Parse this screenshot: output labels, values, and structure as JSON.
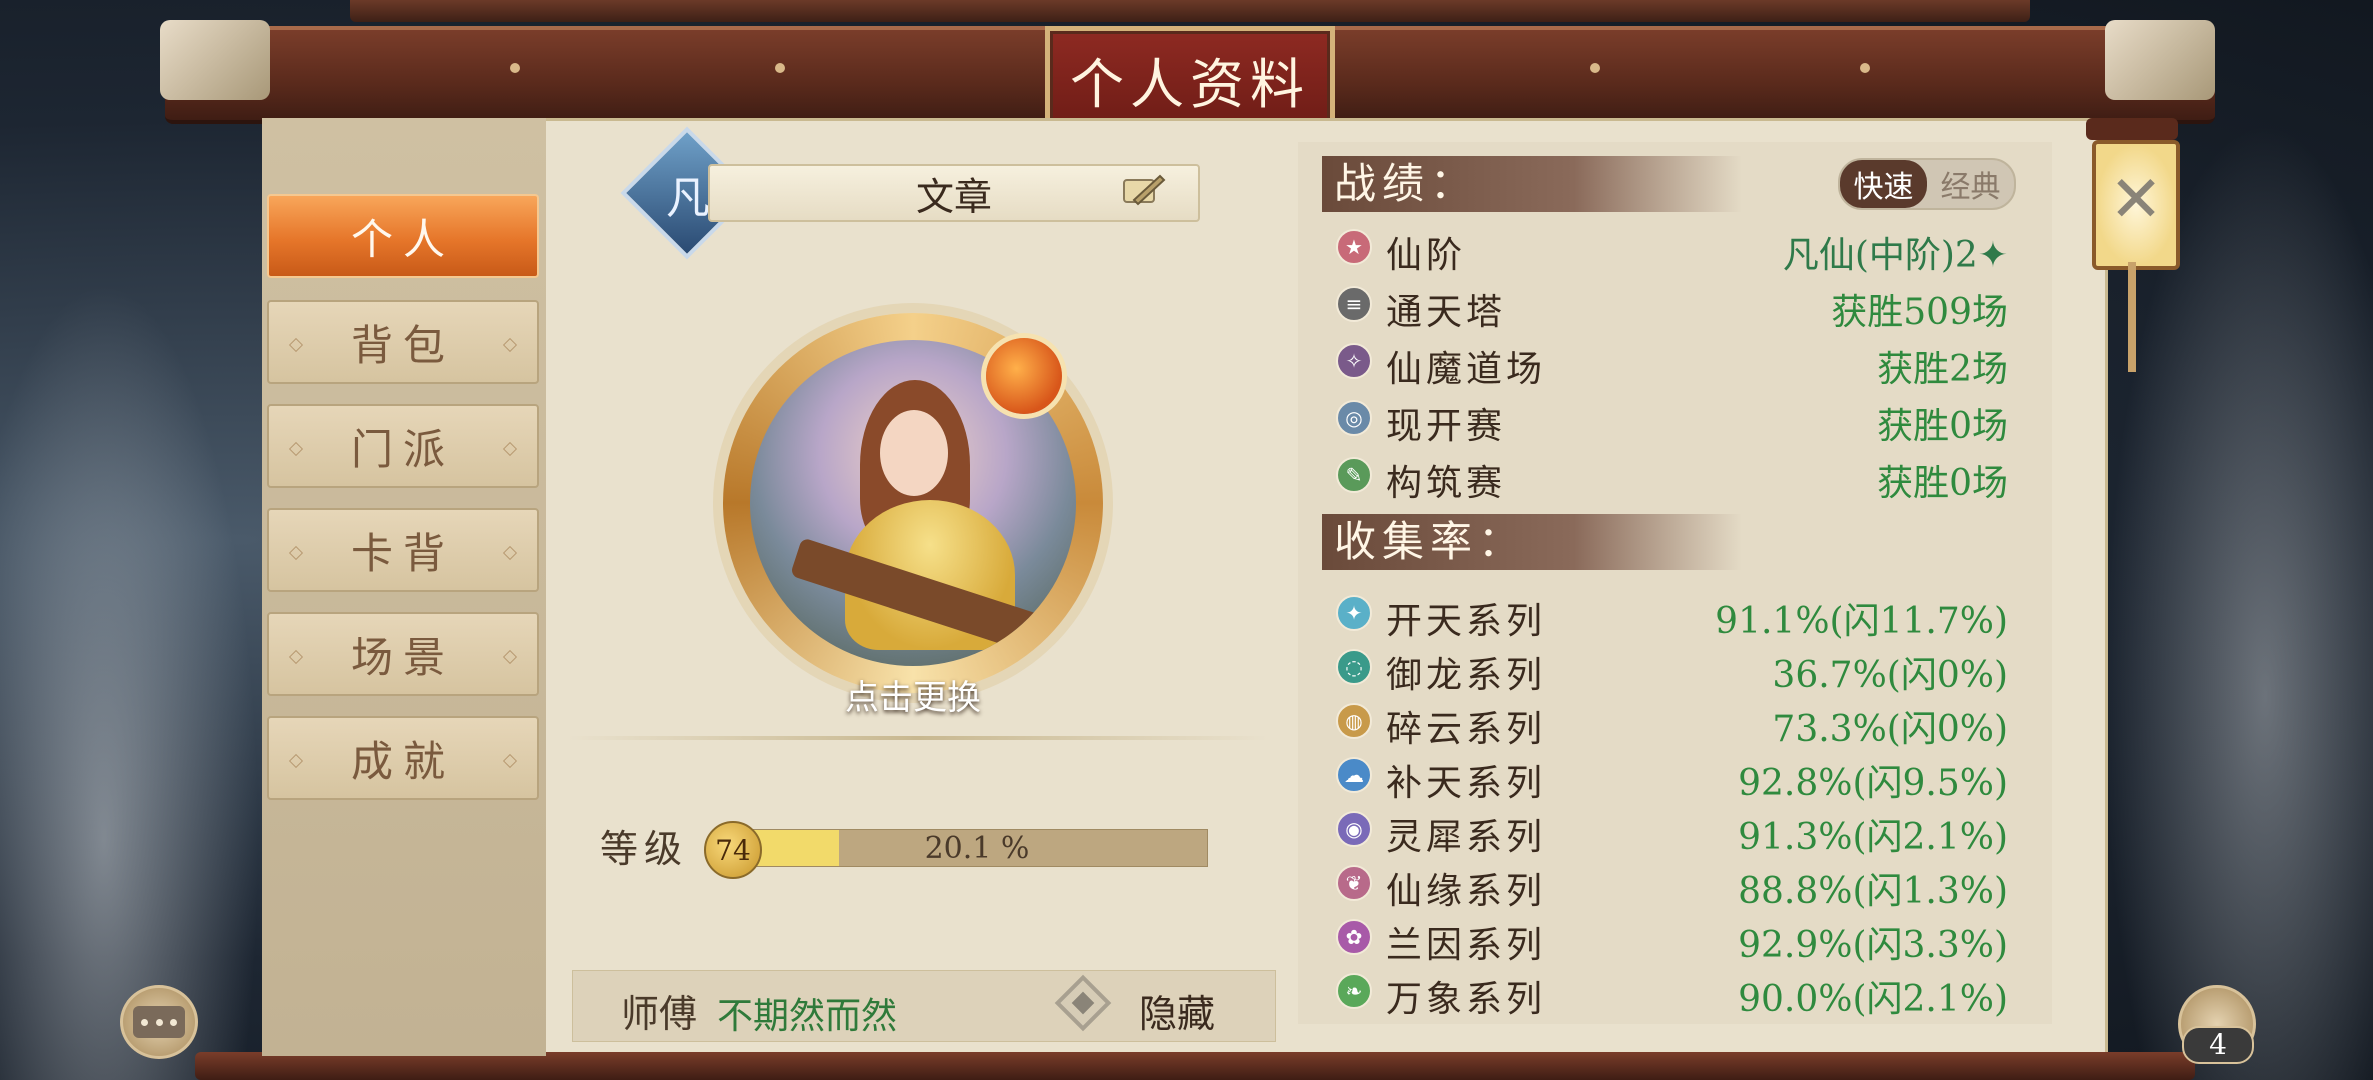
{
  "title": "个人资料",
  "sidebar": {
    "items": [
      {
        "label": "个人",
        "active": true
      },
      {
        "label": "背包",
        "active": false
      },
      {
        "label": "门派",
        "active": false
      },
      {
        "label": "卡背",
        "active": false
      },
      {
        "label": "场景",
        "active": false
      },
      {
        "label": "成就",
        "active": false
      }
    ]
  },
  "profile": {
    "rank_badge": "凡",
    "name": "文章",
    "avatar_change_label": "点击更换",
    "level_label": "等级",
    "level": "74",
    "level_progress_text": "20.1 %",
    "level_progress": 0.201,
    "master_label": "师傅",
    "master_name": "不期然而然",
    "hide_label": "隐藏"
  },
  "stats": {
    "header": "战绩：",
    "mode_options": [
      "快速",
      "经典"
    ],
    "mode_selected": "快速",
    "rows": [
      {
        "label": "仙阶",
        "value": "凡仙(中阶)2✦",
        "icon": "star-icon",
        "color": "#c86a78"
      },
      {
        "label": "通天塔",
        "value": "获胜509场",
        "icon": "tower-icon",
        "color": "#6a6a6a"
      },
      {
        "label": "仙魔道场",
        "value": "获胜2场",
        "icon": "arena-icon",
        "color": "#7a5a8a"
      },
      {
        "label": "现开赛",
        "value": "获胜0场",
        "icon": "draft-icon",
        "color": "#6a8aa8"
      },
      {
        "label": "构筑赛",
        "value": "获胜0场",
        "icon": "build-icon",
        "color": "#5a9a5a"
      }
    ]
  },
  "collection": {
    "header": "收集率：",
    "rows": [
      {
        "label": "开天系列",
        "value": "91.1%(闪11.7%)",
        "icon": "kaitian-icon",
        "color": "#5ab0c8"
      },
      {
        "label": "御龙系列",
        "value": "36.7%(闪0%)",
        "icon": "yulong-icon",
        "color": "#3a9a8a"
      },
      {
        "label": "碎云系列",
        "value": "73.3%(闪0%)",
        "icon": "suiyun-icon",
        "color": "#c89a4a"
      },
      {
        "label": "补天系列",
        "value": "92.8%(闪9.5%)",
        "icon": "butian-icon",
        "color": "#4a8ac8"
      },
      {
        "label": "灵犀系列",
        "value": "91.3%(闪2.1%)",
        "icon": "lingxi-icon",
        "color": "#7a6ab8"
      },
      {
        "label": "仙缘系列",
        "value": "88.8%(闪1.3%)",
        "icon": "xianyuan-icon",
        "color": "#b86a8a"
      },
      {
        "label": "兰因系列",
        "value": "92.9%(闪3.3%)",
        "icon": "lanyin-icon",
        "color": "#a85aa8"
      },
      {
        "label": "万象系列",
        "value": "90.0%(闪2.1%)",
        "icon": "wanxiang-icon",
        "color": "#5aa85a"
      }
    ]
  },
  "close_symbol": "✕",
  "bag_count": "4"
}
